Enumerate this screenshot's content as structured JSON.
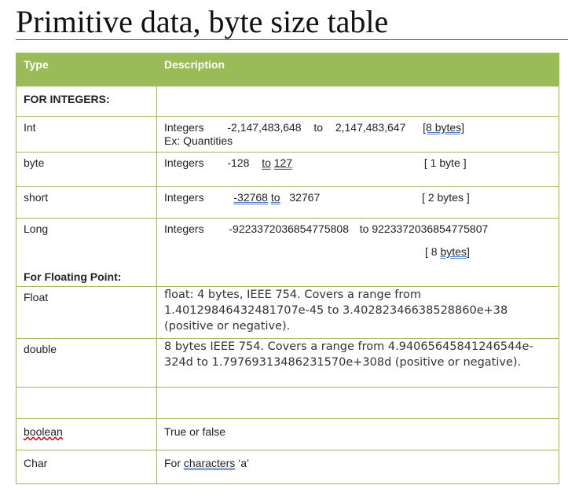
{
  "title": "Primitive data, byte size table",
  "header": {
    "type": "Type",
    "description": "Description"
  },
  "rows": {
    "int_section": {
      "label": "FOR INTEGERS:"
    },
    "int": {
      "type": "Int",
      "kind": "Integers",
      "min": "-2,147,483,648",
      "to": "to",
      "max": "2,147,483,647",
      "bytes": "[8 bytes]",
      "example": "Ex: Quantities"
    },
    "byte": {
      "type": "byte",
      "kind": "Integers",
      "min": "-128",
      "to": "to",
      "max": "127",
      "bytes": "[ 1 byte ]"
    },
    "short": {
      "type": "short",
      "kind": "Integers",
      "min": "-32768",
      "to": "to",
      "max": "32767",
      "bytes": "[ 2 bytes ]"
    },
    "long": {
      "type": "Long",
      "kind": "Integers",
      "min": "-9223372036854775808",
      "to": "to",
      "max": "9223372036854775807",
      "bytes_open": "[ 8",
      "bytes_word": "bytes",
      "bytes_close": "]"
    },
    "float_section": {
      "label": "For Floating Point:"
    },
    "float": {
      "type": "Float",
      "desc": "float: 4 bytes, IEEE 754. Covers a range from 1.40129846432481707e-45 to 3.40282346638528860e+38 (positive or negative)."
    },
    "double": {
      "type": "double",
      "desc": "8 bytes IEEE 754. Covers a range from 4.94065645841246544e-324d to 1.79769313486231570e+308d (positive or negative)."
    },
    "boolean": {
      "type": "boolean",
      "desc": "True or false"
    },
    "char": {
      "type": "Char",
      "prefix": "For",
      "word": "characters",
      "example": "‘a’"
    }
  },
  "colors": {
    "header_bg": "#9bbb59",
    "border": "#9bbb59"
  }
}
